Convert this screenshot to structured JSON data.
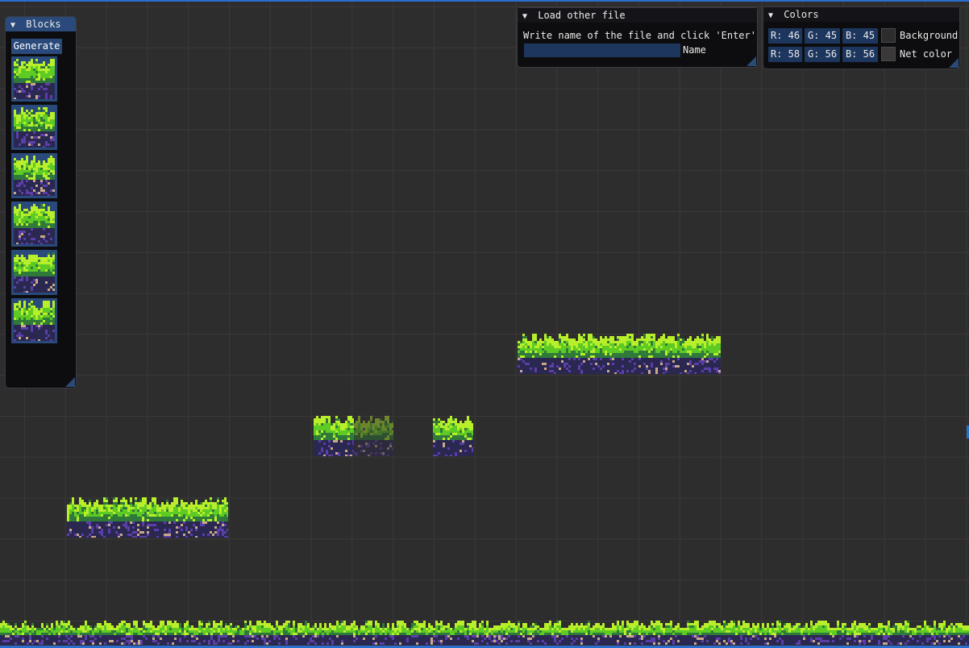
{
  "panels": {
    "blocks": {
      "title": "Blocks",
      "generate_label": "Generate",
      "block_items": [
        "block-1",
        "block-2",
        "block-3",
        "block-4",
        "block-5",
        "block-6"
      ]
    },
    "load_file": {
      "title": "Load other file",
      "help_text": "Write name of the file and click 'Enter'",
      "name_value": "",
      "name_label": "Name"
    },
    "colors": {
      "title": "Colors",
      "background": {
        "r": "R: 46",
        "g": "G: 45",
        "b": "B: 45",
        "label": "Background",
        "hex": "#2e2d2d"
      },
      "net": {
        "r": "R: 58",
        "g": "G: 56",
        "b": "B: 56",
        "label": "Net color",
        "hex": "#3a3838"
      }
    }
  },
  "icons": {
    "collapse": "triangle-down-icon",
    "resize": "resize-grip-icon"
  },
  "colors": {
    "accent": "#294a7a",
    "input_bg": "#1d365e",
    "window_bg": "#0d0d0f",
    "grass_light": "#b8ee2a",
    "grass_mid": "#5ecb24",
    "grass_dark": "#2f7a3a",
    "soil_dark": "#2a2750",
    "soil_purple": "#5b3fa8",
    "stone": "#c9a98a"
  }
}
